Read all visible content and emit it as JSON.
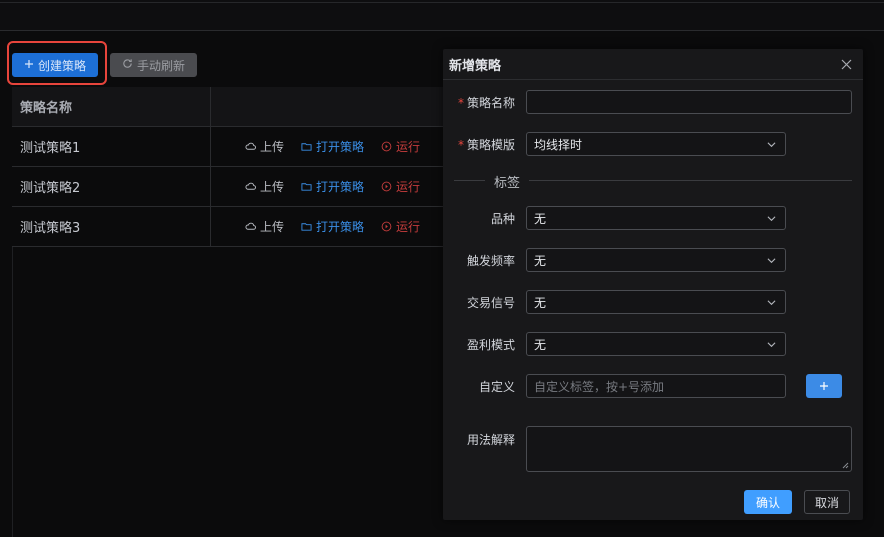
{
  "toolbar": {
    "create_label": "创建策略",
    "refresh_label": "手动刷新"
  },
  "table": {
    "header_name": "策略名称",
    "rows": [
      {
        "name": "测试策略1",
        "upload": "上传",
        "open": "打开策略",
        "run": "运行"
      },
      {
        "name": "测试策略2",
        "upload": "上传",
        "open": "打开策略",
        "run": "运行"
      },
      {
        "name": "测试策略3",
        "upload": "上传",
        "open": "打开策略",
        "run": "运行"
      }
    ]
  },
  "dialog": {
    "title": "新增策略",
    "fields": {
      "name_label": "策略名称",
      "name_value": "",
      "template_label": "策略模版",
      "template_value": "均线择时",
      "tags_divider": "标签",
      "variety_label": "品种",
      "variety_value": "无",
      "frequency_label": "触发频率",
      "frequency_value": "无",
      "signal_label": "交易信号",
      "signal_value": "无",
      "profit_label": "盈利模式",
      "profit_value": "无",
      "custom_label": "自定义",
      "custom_placeholder": "自定义标签，按+号添加",
      "usage_label": "用法解释",
      "usage_value": ""
    },
    "confirm_label": "确认",
    "cancel_label": "取消"
  },
  "colors": {
    "primary": "#409eff",
    "required": "#e6463e",
    "run": "#c43c3c",
    "open": "#3a8ee6",
    "highlight": "#e8453c"
  }
}
